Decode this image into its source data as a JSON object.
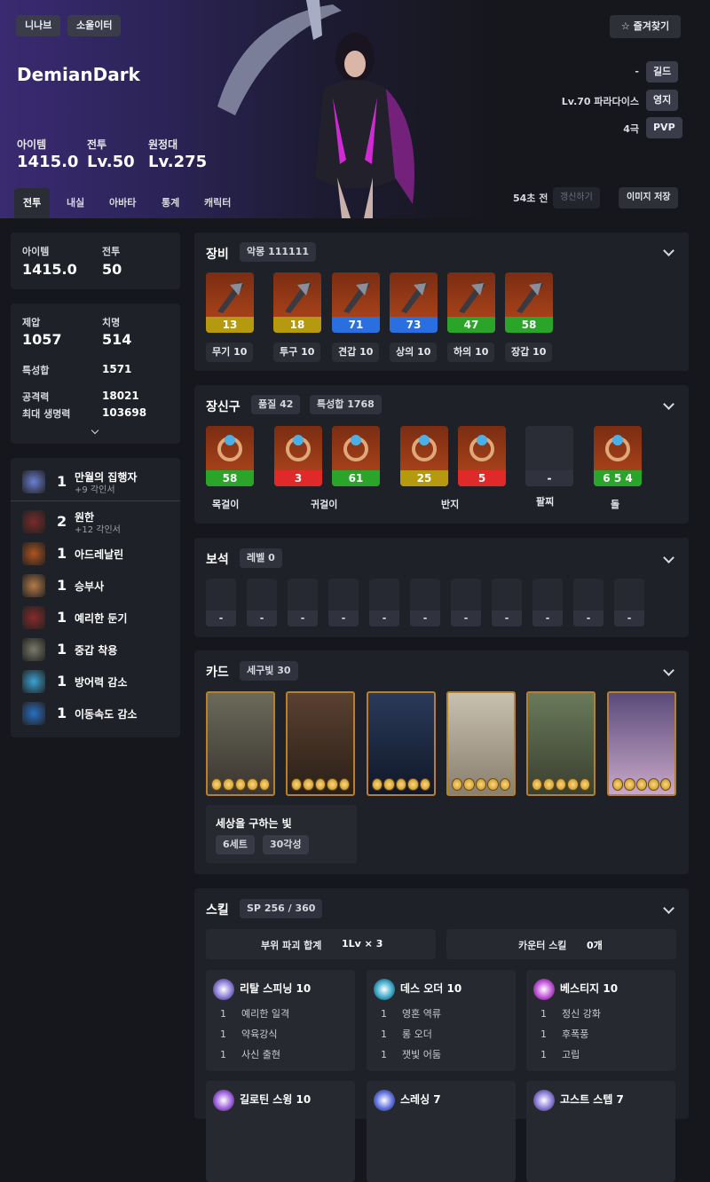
{
  "header": {
    "server": "니나브",
    "class": "소울이터",
    "name": "DemianDark",
    "bookmark": "즐겨찾기",
    "stats": [
      {
        "label": "아이템",
        "value": "1415.0"
      },
      {
        "label": "전투",
        "value": "Lv.50"
      },
      {
        "label": "원정대",
        "value": "Lv.275"
      }
    ],
    "guild": {
      "value": "-",
      "label": "길드"
    },
    "territory": {
      "value": "Lv.70 파라다이스",
      "label": "영지"
    },
    "pvp": {
      "value": "4극",
      "label": "PVP"
    },
    "updated": "54초 전",
    "refresh": "갱신하기",
    "save_image": "이미지 저장",
    "tabs": [
      "전투",
      "내실",
      "아바타",
      "통계",
      "캐릭터"
    ]
  },
  "side": {
    "item_label": "아이템",
    "item_value": "1415.0",
    "combat_label": "전투",
    "combat_value": "50",
    "stats": [
      {
        "k": "제압",
        "v": "1057"
      },
      {
        "k": "치명",
        "v": "514"
      },
      {
        "k": "특성합",
        "v": "1571"
      },
      {
        "k": "공격력",
        "v": "18021"
      },
      {
        "k": "최대 생명력",
        "v": "103698"
      }
    ],
    "engravings": [
      {
        "level": "1",
        "name": "만월의 집행자",
        "sub": "+9 각인서",
        "color": "#6b7fd4"
      },
      {
        "level": "2",
        "name": "원한",
        "sub": "+12 각인서",
        "color": "#7a2a2a"
      },
      {
        "level": "1",
        "name": "아드레날린",
        "sub": "",
        "color": "#b0541f"
      },
      {
        "level": "1",
        "name": "승부사",
        "sub": "",
        "color": "#b57b4a"
      },
      {
        "level": "1",
        "name": "예리한 둔기",
        "sub": "",
        "color": "#8a2a2a"
      },
      {
        "level": "1",
        "name": "중갑 착용",
        "sub": "",
        "color": "#7a7a6a"
      },
      {
        "level": "1",
        "name": "방어력 감소",
        "sub": "",
        "color": "#3aa3d4"
      },
      {
        "level": "1",
        "name": "이동속도 감소",
        "sub": "",
        "color": "#2a6fc4"
      }
    ]
  },
  "equipment": {
    "title": "장비",
    "badge": "악몽 111111",
    "items": [
      {
        "q": "13",
        "label": "무기 10",
        "qcolor": "#b59a10"
      },
      {
        "q": "18",
        "label": "투구 10",
        "qcolor": "#b59a10"
      },
      {
        "q": "71",
        "label": "견갑 10",
        "qcolor": "#2a6fe0"
      },
      {
        "q": "73",
        "label": "상의 10",
        "qcolor": "#2a6fe0"
      },
      {
        "q": "47",
        "label": "하의 10",
        "qcolor": "#2aa52a"
      },
      {
        "q": "58",
        "label": "장갑 10",
        "qcolor": "#2aa52a"
      }
    ]
  },
  "accessory": {
    "title": "장신구",
    "badge1": "품질 42",
    "badge2": "특성합 1768",
    "items": [
      {
        "q": "58",
        "qcolor": "#2aa52a"
      },
      {
        "q": "3",
        "qcolor": "#e02a2a"
      },
      {
        "q": "61",
        "qcolor": "#2aa52a"
      },
      {
        "q": "25",
        "qcolor": "#b59a10"
      },
      {
        "q": "5",
        "qcolor": "#e02a2a"
      },
      {
        "q": "-",
        "qcolor": "#30333d"
      },
      {
        "q": "6 5 4",
        "qcolor": "#2aa52a"
      }
    ],
    "labels": [
      "목걸이",
      "귀걸이",
      "반지",
      "팔찌",
      "돌"
    ]
  },
  "gems": {
    "title": "보석",
    "badge": "레벨 0",
    "slots": [
      "-",
      "-",
      "-",
      "-",
      "-",
      "-",
      "-",
      "-",
      "-",
      "-",
      "-"
    ]
  },
  "cards": {
    "title": "카드",
    "badge": "세구빛 30",
    "set_name": "세상을 구하는 빛",
    "set_badges": [
      "6세트",
      "30각성"
    ]
  },
  "skills": {
    "title": "스킬",
    "badge": "SP 256 / 360",
    "destroy_label": "부위 파괴 합계",
    "destroy_value": "1Lv × 3",
    "counter_label": "카운터 스킬",
    "counter_value": "0개",
    "list": [
      {
        "name": "리탈 스피닝 10",
        "tripods": [
          {
            "l": "1",
            "n": "예리한 일격"
          },
          {
            "l": "1",
            "n": "약육강식"
          },
          {
            "l": "1",
            "n": "사신 출현"
          }
        ]
      },
      {
        "name": "데스 오더 10",
        "tripods": [
          {
            "l": "1",
            "n": "영혼 역류"
          },
          {
            "l": "1",
            "n": "롱 오더"
          },
          {
            "l": "1",
            "n": "잿빛 어둠"
          }
        ]
      },
      {
        "name": "베스티지 10",
        "tripods": [
          {
            "l": "1",
            "n": "정신 강화"
          },
          {
            "l": "1",
            "n": "후폭풍"
          },
          {
            "l": "1",
            "n": "고립"
          }
        ]
      },
      {
        "name": "길로틴 스윙 10",
        "tripods": []
      },
      {
        "name": "스레싱 7",
        "tripods": []
      },
      {
        "name": "고스트 스텝 7",
        "tripods": []
      }
    ]
  }
}
